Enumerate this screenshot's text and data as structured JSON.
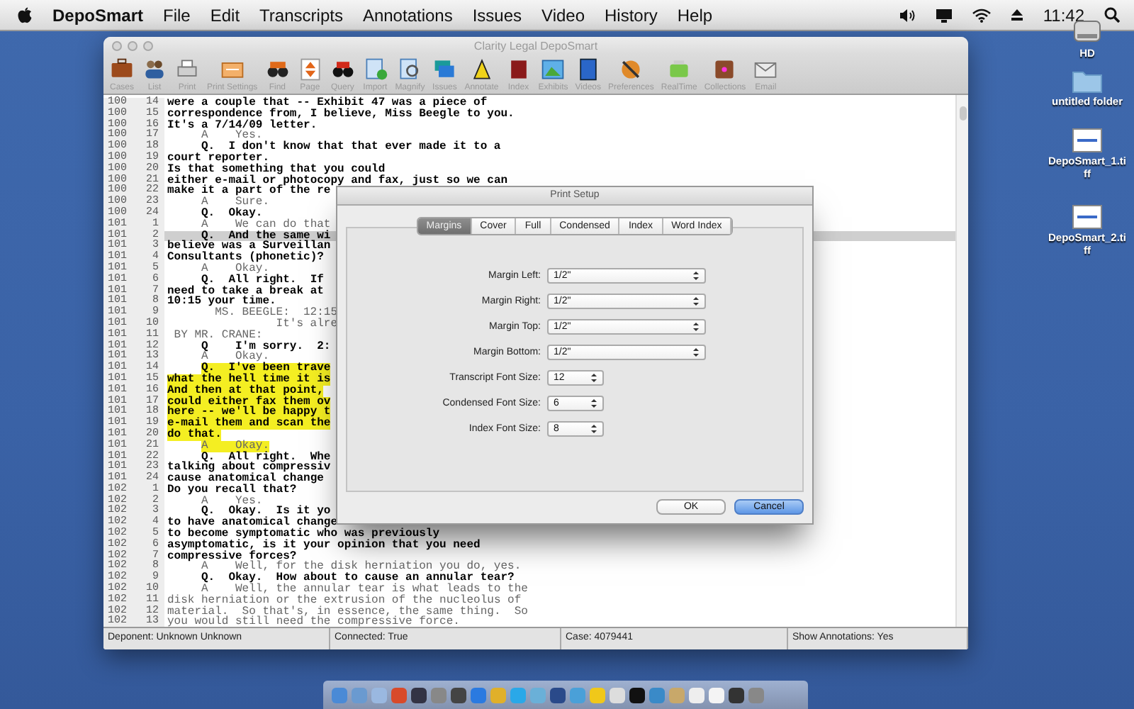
{
  "menubar": {
    "app": "DepoSmart",
    "menus": [
      "File",
      "Edit",
      "Transcripts",
      "Annotations",
      "Issues",
      "Video",
      "History",
      "Help"
    ],
    "clock": "11:42"
  },
  "desktop_icons": [
    {
      "label": "HD",
      "kind": "drive"
    },
    {
      "label": "untitled folder",
      "kind": "folder"
    },
    {
      "label": "DepoSmart_1.tiff",
      "kind": "image"
    },
    {
      "label": "DepoSmart_2.tiff",
      "kind": "image"
    }
  ],
  "window": {
    "title": "Clarity Legal DepoSmart",
    "toolbar": [
      "Cases",
      "List",
      "Print",
      "Print Settings",
      "Find",
      "Page",
      "Query",
      "Import",
      "Magnify",
      "Issues",
      "Annotate",
      "Index",
      "Exhibits",
      "Videos",
      "Preferences",
      "RealTime",
      "Collections",
      "Email"
    ],
    "transcript": [
      {
        "page": "100",
        "line": "14",
        "kind": "testimony",
        "text": "were a couple that -- Exhibit 47 was a piece of",
        "highlighted": false,
        "selected": false
      },
      {
        "page": "100",
        "line": "15",
        "kind": "testimony",
        "text": "correspondence from, I believe, Miss Beegle to you.",
        "highlighted": false,
        "selected": false
      },
      {
        "page": "100",
        "line": "16",
        "kind": "testimony",
        "text": "It's a 7/14/09 letter.",
        "highlighted": false,
        "selected": false
      },
      {
        "page": "100",
        "line": "17",
        "kind": "answer",
        "text": "A    Yes.",
        "highlighted": false,
        "selected": false
      },
      {
        "page": "100",
        "line": "18",
        "kind": "question",
        "text": "Q.  I don't know that that ever made it to a",
        "highlighted": false,
        "selected": false
      },
      {
        "page": "100",
        "line": "19",
        "kind": "testimony",
        "text": "court reporter.",
        "highlighted": false,
        "selected": false
      },
      {
        "page": "100",
        "line": "20",
        "kind": "testimony",
        "text": "Is that something that you could",
        "highlighted": false,
        "selected": false
      },
      {
        "page": "100",
        "line": "21",
        "kind": "testimony",
        "text": "either e-mail or photocopy and fax, just so we can",
        "highlighted": false,
        "selected": false
      },
      {
        "page": "100",
        "line": "22",
        "kind": "testimony",
        "text": "make it a part of the re",
        "highlighted": false,
        "selected": false
      },
      {
        "page": "100",
        "line": "23",
        "kind": "answer",
        "text": "A    Sure.",
        "highlighted": false,
        "selected": false
      },
      {
        "page": "100",
        "line": "24",
        "kind": "question",
        "text": "Q.  Okay.",
        "highlighted": false,
        "selected": false
      },
      {
        "page": "101",
        "line": "1",
        "kind": "answer",
        "text": "A    We can do that",
        "highlighted": false,
        "selected": false
      },
      {
        "page": "101",
        "line": "2",
        "kind": "question",
        "text": "Q.  And the same wi",
        "highlighted": false,
        "selected": true
      },
      {
        "page": "101",
        "line": "3",
        "kind": "testimony",
        "text": "believe was a Surveillan",
        "highlighted": false,
        "selected": false
      },
      {
        "page": "101",
        "line": "4",
        "kind": "testimony",
        "text": "Consultants (phonetic)?",
        "highlighted": false,
        "selected": false
      },
      {
        "page": "101",
        "line": "5",
        "kind": "answer",
        "text": "A    Okay.",
        "highlighted": false,
        "selected": false
      },
      {
        "page": "101",
        "line": "6",
        "kind": "question",
        "text": "Q.  All right.  If",
        "highlighted": false,
        "selected": false
      },
      {
        "page": "101",
        "line": "7",
        "kind": "testimony",
        "text": "need to take a break at",
        "highlighted": false,
        "selected": false
      },
      {
        "page": "101",
        "line": "8",
        "kind": "testimony",
        "text": "10:15 your time.",
        "highlighted": false,
        "selected": false
      },
      {
        "page": "101",
        "line": "9",
        "kind": "colloquy",
        "text": "MS. BEEGLE:  12:15",
        "highlighted": false,
        "selected": false
      },
      {
        "page": "101",
        "line": "10",
        "kind": "colloquy_cont",
        "text": "It's alre",
        "highlighted": false,
        "selected": false
      },
      {
        "page": "101",
        "line": "11",
        "kind": "heading",
        "text": "BY MR. CRANE:",
        "highlighted": false,
        "selected": false
      },
      {
        "page": "101",
        "line": "12",
        "kind": "question",
        "text": "Q    I'm sorry.  2:",
        "highlighted": false,
        "selected": false
      },
      {
        "page": "101",
        "line": "13",
        "kind": "answer",
        "text": "A    Okay.",
        "highlighted": false,
        "selected": false
      },
      {
        "page": "101",
        "line": "14",
        "kind": "question",
        "text": "Q.  I've been trave",
        "highlighted": true,
        "selected": false
      },
      {
        "page": "101",
        "line": "15",
        "kind": "testimony",
        "text": "what the hell time it is",
        "highlighted": true,
        "selected": false
      },
      {
        "page": "101",
        "line": "16",
        "kind": "testimony",
        "text": "And then at that point,",
        "highlighted": true,
        "selected": false
      },
      {
        "page": "101",
        "line": "17",
        "kind": "testimony",
        "text": "could either fax them ov",
        "highlighted": true,
        "selected": false
      },
      {
        "page": "101",
        "line": "18",
        "kind": "testimony",
        "text": "here -- we'll be happy t",
        "highlighted": true,
        "selected": false
      },
      {
        "page": "101",
        "line": "19",
        "kind": "testimony",
        "text": "e-mail them and scan the",
        "highlighted": true,
        "selected": false
      },
      {
        "page": "101",
        "line": "20",
        "kind": "testimony",
        "text": "do that.",
        "highlighted": true,
        "selected": false
      },
      {
        "page": "101",
        "line": "21",
        "kind": "answer",
        "text": "A    Okay.",
        "highlighted": true,
        "selected": false
      },
      {
        "page": "101",
        "line": "22",
        "kind": "question",
        "text": "Q.  All right.  Whe",
        "highlighted": false,
        "selected": false
      },
      {
        "page": "101",
        "line": "23",
        "kind": "testimony",
        "text": "talking about compressiv",
        "highlighted": false,
        "selected": false
      },
      {
        "page": "101",
        "line": "24",
        "kind": "testimony",
        "text": "cause anatomical change",
        "highlighted": false,
        "selected": false
      },
      {
        "page": "102",
        "line": "1",
        "kind": "testimony",
        "text": "Do you recall that?",
        "highlighted": false,
        "selected": false
      },
      {
        "page": "102",
        "line": "2",
        "kind": "answer",
        "text": "A    Yes.",
        "highlighted": false,
        "selected": false
      },
      {
        "page": "102",
        "line": "3",
        "kind": "question",
        "text": "Q.  Okay.  Is it yo",
        "highlighted": false,
        "selected": false
      },
      {
        "page": "102",
        "line": "4",
        "kind": "testimony",
        "text": "to have anatomical change",
        "highlighted": false,
        "selected": false
      },
      {
        "page": "102",
        "line": "5",
        "kind": "testimony",
        "text": "to become symptomatic who was previously",
        "highlighted": false,
        "selected": false
      },
      {
        "page": "102",
        "line": "6",
        "kind": "testimony",
        "text": "asymptomatic, is it your opinion that you need",
        "highlighted": false,
        "selected": false
      },
      {
        "page": "102",
        "line": "7",
        "kind": "testimony",
        "text": "compressive forces?",
        "highlighted": false,
        "selected": false
      },
      {
        "page": "102",
        "line": "8",
        "kind": "answer",
        "text": "A    Well, for the disk herniation you do, yes.",
        "highlighted": false,
        "selected": false
      },
      {
        "page": "102",
        "line": "9",
        "kind": "question",
        "text": "Q.  Okay.  How about to cause an annular tear?",
        "highlighted": false,
        "selected": false
      },
      {
        "page": "102",
        "line": "10",
        "kind": "answer",
        "text": "A    Well, the annular tear is what leads to the",
        "highlighted": false,
        "selected": false
      },
      {
        "page": "102",
        "line": "11",
        "kind": "answer_cont",
        "text": "disk herniation or the extrusion of the nucleolus of",
        "highlighted": false,
        "selected": false
      },
      {
        "page": "102",
        "line": "12",
        "kind": "answer_cont",
        "text": "material.  So that's, in essence, the same thing.  So",
        "highlighted": false,
        "selected": false
      },
      {
        "page": "102",
        "line": "13",
        "kind": "answer_cont",
        "text": "you would still need the compressive force.",
        "highlighted": false,
        "selected": false
      }
    ],
    "status_bar": [
      "Deponent: Unknown Unknown",
      "Connected: True",
      "Case: 4079441",
      "Show Annotations: Yes"
    ]
  },
  "dialog": {
    "title": "Print Setup",
    "tabs": [
      {
        "label": "Margins",
        "selected": true
      },
      {
        "label": "Cover",
        "selected": false
      },
      {
        "label": "Full",
        "selected": false
      },
      {
        "label": "Condensed",
        "selected": false
      },
      {
        "label": "Index",
        "selected": false
      },
      {
        "label": "Word Index",
        "selected": false
      }
    ],
    "fields": [
      {
        "label": "Margin Left:",
        "value": "1/2\"",
        "kind": "wide"
      },
      {
        "label": "Margin Right:",
        "value": "1/2\"",
        "kind": "wide"
      },
      {
        "label": "Margin Top:",
        "value": "1/2\"",
        "kind": "wide"
      },
      {
        "label": "Margin Bottom:",
        "value": "1/2\"",
        "kind": "wide"
      },
      {
        "label": "Transcript Font Size:",
        "value": "12",
        "kind": "narrow"
      },
      {
        "label": "Condensed Font Size:",
        "value": "6",
        "kind": "narrow"
      },
      {
        "label": "Index Font Size:",
        "value": "8",
        "kind": "narrow"
      }
    ],
    "buttons": [
      {
        "label": "OK",
        "kind": "normal"
      },
      {
        "label": "Cancel",
        "kind": "default"
      }
    ]
  }
}
